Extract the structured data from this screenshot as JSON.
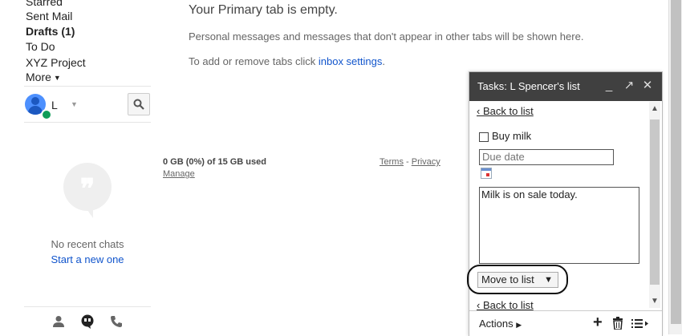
{
  "nav": {
    "items": [
      {
        "label": "Starred"
      },
      {
        "label": "Sent Mail"
      },
      {
        "label": "Drafts (1)"
      },
      {
        "label": "To Do"
      },
      {
        "label": "XYZ Project"
      },
      {
        "label": "More"
      }
    ],
    "user": {
      "name": "L"
    },
    "chats": {
      "empty_text": "No recent chats",
      "start_link": "Start a new one"
    }
  },
  "main": {
    "empty_title": "Your Primary tab is empty.",
    "personal_msg": "Personal messages and messages that don't appear in other tabs will be shown here.",
    "tabs_msg_prefix": "To add or remove tabs click ",
    "tabs_msg_link": "inbox settings",
    "tabs_msg_suffix": ".",
    "storage": "0 GB (0%) of 15 GB used",
    "manage": "Manage",
    "terms": "Terms",
    "sep": " - ",
    "privacy": "Privacy"
  },
  "tasks": {
    "title": "Tasks: L Spencer's list",
    "back_label": "‹ Back to list",
    "task_title": "Buy milk",
    "due_placeholder": "Due date",
    "notes": "Milk is on sale today.",
    "move_label": "Move to list",
    "actions_label": "Actions",
    "colors": {
      "header": "#404040"
    }
  }
}
